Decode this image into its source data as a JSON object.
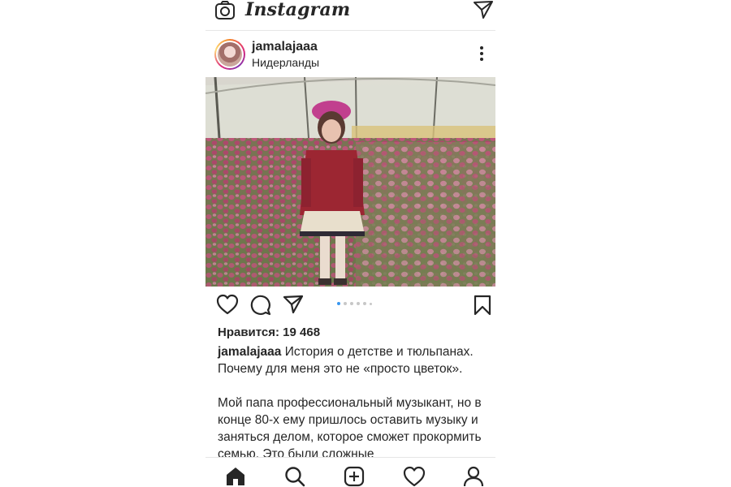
{
  "app": {
    "name": "Instagram"
  },
  "topbar": {
    "camera_icon": "camera-icon",
    "direct_icon": "paper-plane-icon"
  },
  "post": {
    "username": "jamalajaaa",
    "location": "Нидерланды",
    "likes_text": "Нравится: 19 468",
    "caption_username": "jamalajaaa",
    "caption_line1": " История о детстве и тюльпанах. Почему для меня это не «просто цветок».",
    "caption_line2": "Мой папа профессиональный музыкант, но в конце 80-х ему пришлось оставить музыку и заняться делом, которое сможет прокормить семью. Это были сложные",
    "carousel": {
      "count": 6,
      "active": 0
    },
    "photo_description": "girl-in-tulip-greenhouse"
  },
  "colors": {
    "text": "#262626",
    "active_dot": "#3897f0",
    "inactive_dot": "#c7c7c7",
    "divider": "#e6e6e6"
  },
  "tabbar": {
    "items": [
      "home-icon",
      "search-icon",
      "new-post-icon",
      "activity-heart-icon",
      "profile-icon"
    ]
  }
}
